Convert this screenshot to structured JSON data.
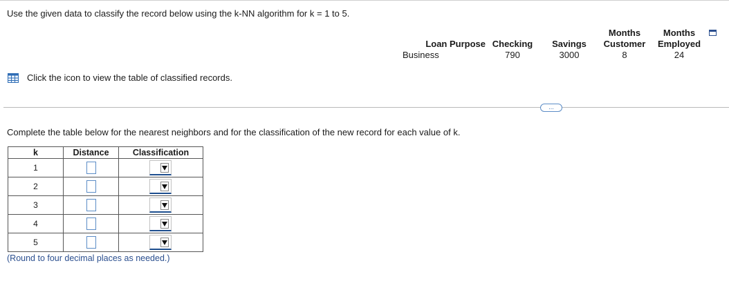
{
  "question": "Use the given data to classify the record below using the k-NN algorithm for k = 1 to 5.",
  "record": {
    "loan_purpose": {
      "header": "Loan Purpose",
      "value": "Business"
    },
    "checking": {
      "header": "Checking",
      "value": "790"
    },
    "savings": {
      "header": "Savings",
      "value": "3000"
    },
    "months_customer": {
      "header_line1": "Months",
      "header_line2": "Customer",
      "value": "8"
    },
    "months_employed": {
      "header_line1": "Months",
      "header_line2": "Employed",
      "value": "24"
    }
  },
  "icons": {
    "copy": "copy-icon",
    "table": "table-grid-icon"
  },
  "table_link_text": "Click the icon to view the table of classified records.",
  "more_button": "...",
  "instruction": "Complete the table below for the nearest neighbors and for the classification of the new record for each value of k.",
  "answer_table": {
    "headers": {
      "k": "k",
      "distance": "Distance",
      "classification": "Classification"
    },
    "rows": [
      {
        "k": "1",
        "distance": "",
        "classification": ""
      },
      {
        "k": "2",
        "distance": "",
        "classification": ""
      },
      {
        "k": "3",
        "distance": "",
        "classification": ""
      },
      {
        "k": "4",
        "distance": "",
        "classification": ""
      },
      {
        "k": "5",
        "distance": "",
        "classification": ""
      }
    ]
  },
  "note": "(Round to four decimal places as needed.)",
  "colors": {
    "accent": "#1d4e8f",
    "link": "#2b4f8f",
    "input_border": "#5b8cc6"
  }
}
